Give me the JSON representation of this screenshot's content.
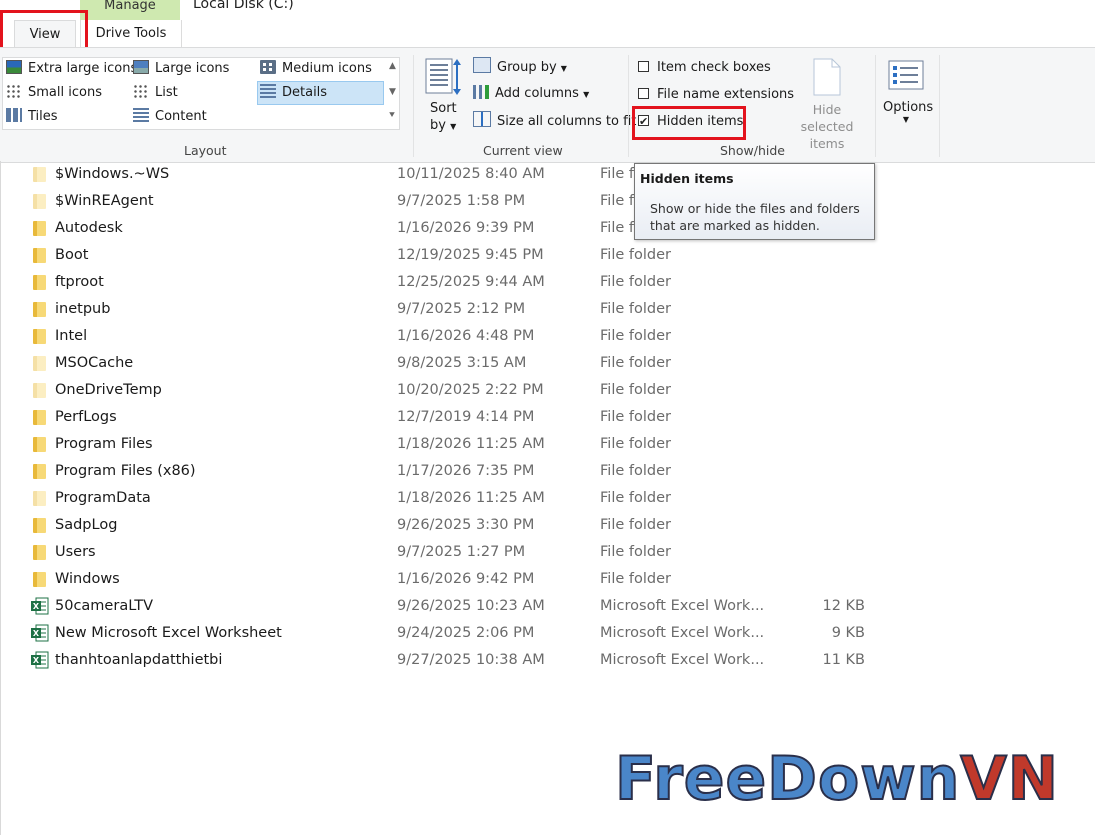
{
  "title_bar": {
    "manage_tab": "Manage",
    "window_title": "Local Disk (C:)"
  },
  "tabs": {
    "view": "View",
    "drive_tools": "Drive Tools"
  },
  "ribbon": {
    "layout": {
      "items": [
        "Extra large icons",
        "Large icons",
        "Medium icons",
        "Small icons",
        "List",
        "Details",
        "Tiles",
        "Content"
      ],
      "selected": "Details",
      "label": "Layout"
    },
    "current_view": {
      "sort_line1": "Sort",
      "sort_line2": "by",
      "group_by": "Group by",
      "add_columns": "Add columns",
      "size_all": "Size all columns to fit",
      "label": "Current view"
    },
    "show_hide": {
      "item_check_boxes": "Item check boxes",
      "file_name_extensions": "File name extensions",
      "hidden_items": "Hidden items",
      "hidden_items_checked": true,
      "hide_selected_line1": "Hide selected",
      "hide_selected_line2": "items",
      "label": "Show/hide"
    },
    "options": "Options"
  },
  "tooltip": {
    "title": "Hidden items",
    "line1": "Show or hide the files and folders",
    "line2": "that are marked as hidden."
  },
  "files": [
    {
      "name": "$Windows.~WS",
      "date": "10/11/2025 8:40 AM",
      "type": "File f",
      "size": "",
      "kind": "folder",
      "hidden": true
    },
    {
      "name": "$WinREAgent",
      "date": "9/7/2025 1:58 PM",
      "type": "File f",
      "size": "",
      "kind": "folder",
      "hidden": true
    },
    {
      "name": "Autodesk",
      "date": "1/16/2026 9:39 PM",
      "type": "File f",
      "size": "",
      "kind": "folder",
      "hidden": false
    },
    {
      "name": "Boot",
      "date": "12/19/2025 9:45 PM",
      "type": "File folder",
      "size": "",
      "kind": "folder",
      "hidden": false
    },
    {
      "name": "ftproot",
      "date": "12/25/2025 9:44 AM",
      "type": "File folder",
      "size": "",
      "kind": "folder",
      "hidden": false
    },
    {
      "name": "inetpub",
      "date": "9/7/2025 2:12 PM",
      "type": "File folder",
      "size": "",
      "kind": "folder",
      "hidden": false
    },
    {
      "name": "Intel",
      "date": "1/16/2026 4:48 PM",
      "type": "File folder",
      "size": "",
      "kind": "folder",
      "hidden": false
    },
    {
      "name": "MSOCache",
      "date": "9/8/2025 3:15 AM",
      "type": "File folder",
      "size": "",
      "kind": "folder",
      "hidden": true
    },
    {
      "name": "OneDriveTemp",
      "date": "10/20/2025 2:22 PM",
      "type": "File folder",
      "size": "",
      "kind": "folder",
      "hidden": true
    },
    {
      "name": "PerfLogs",
      "date": "12/7/2019 4:14 PM",
      "type": "File folder",
      "size": "",
      "kind": "folder",
      "hidden": false
    },
    {
      "name": "Program Files",
      "date": "1/18/2026 11:25 AM",
      "type": "File folder",
      "size": "",
      "kind": "folder",
      "hidden": false
    },
    {
      "name": "Program Files (x86)",
      "date": "1/17/2026 7:35 PM",
      "type": "File folder",
      "size": "",
      "kind": "folder",
      "hidden": false
    },
    {
      "name": "ProgramData",
      "date": "1/18/2026 11:25 AM",
      "type": "File folder",
      "size": "",
      "kind": "folder",
      "hidden": true
    },
    {
      "name": "SadpLog",
      "date": "9/26/2025 3:30 PM",
      "type": "File folder",
      "size": "",
      "kind": "folder",
      "hidden": false
    },
    {
      "name": "Users",
      "date": "9/7/2025 1:27 PM",
      "type": "File folder",
      "size": "",
      "kind": "folder",
      "hidden": false
    },
    {
      "name": "Windows",
      "date": "1/16/2026 9:42 PM",
      "type": "File folder",
      "size": "",
      "kind": "folder",
      "hidden": false
    },
    {
      "name": "50cameraLTV",
      "date": "9/26/2025 10:23 AM",
      "type": "Microsoft Excel Work...",
      "size": "12 KB",
      "kind": "excel",
      "hidden": false
    },
    {
      "name": "New Microsoft Excel Worksheet",
      "date": "9/24/2025 2:06 PM",
      "type": "Microsoft Excel Work...",
      "size": "9 KB",
      "kind": "excel",
      "hidden": false
    },
    {
      "name": "thanhtoanlapdatthietbi",
      "date": "9/27/2025 10:38 AM",
      "type": "Microsoft Excel Work...",
      "size": "11 KB",
      "kind": "excel",
      "hidden": false
    }
  ],
  "watermark": {
    "part1": "FreeDown",
    "part2": "VN"
  },
  "colors": {
    "highlight_red": "#e3131d",
    "manage_tab": "#cfe9b0",
    "selected_layout": "#cce4f7",
    "folder": "#f0c75a",
    "excel_green": "#1d7044",
    "watermark_blue": "#4a86c9",
    "watermark_red": "#c0392b"
  }
}
